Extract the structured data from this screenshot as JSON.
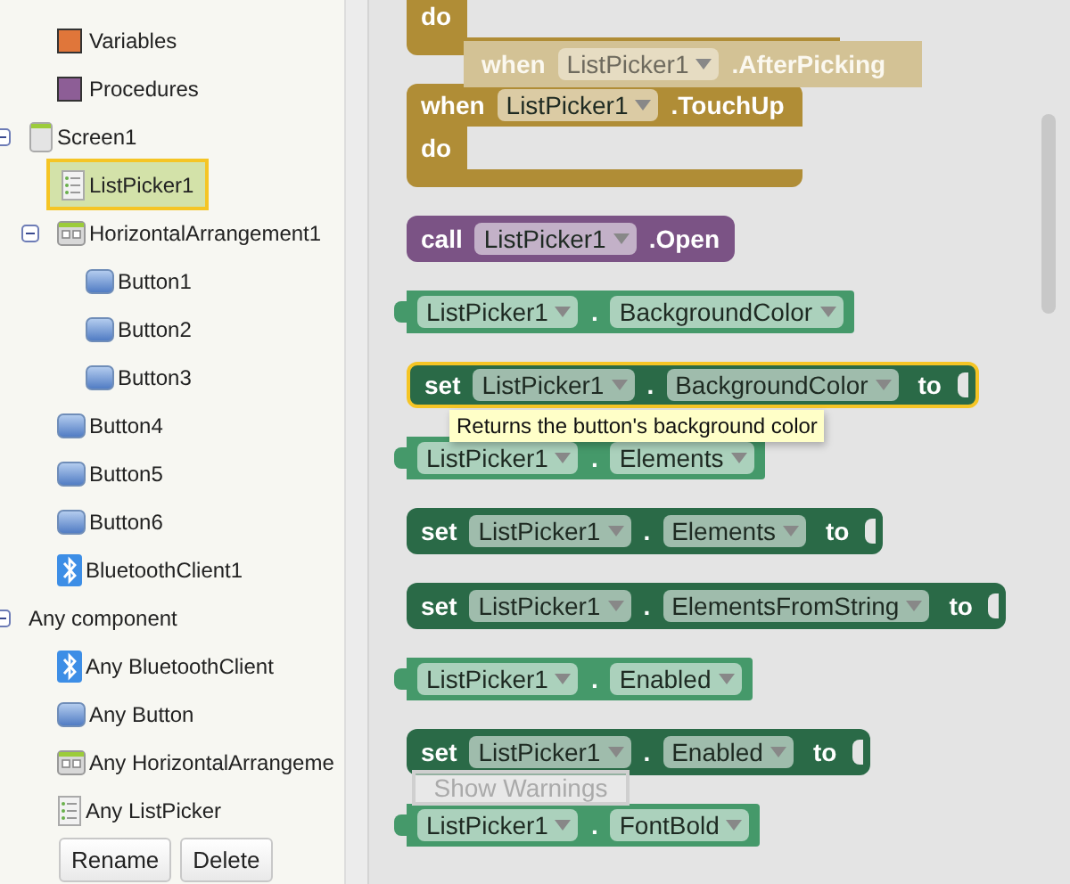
{
  "builtin": [
    {
      "label": "Variables",
      "color": "#e0763a"
    },
    {
      "label": "Procedures",
      "color": "#8d5e96"
    }
  ],
  "tree": [
    {
      "label": "Screen1",
      "kind": "screen",
      "expanded": true,
      "selected": false,
      "children": [
        {
          "label": "ListPicker1",
          "kind": "listpicker",
          "selected": true
        },
        {
          "label": "HorizontalArrangement1",
          "kind": "arrangement",
          "expanded": true,
          "selected": false,
          "children": [
            {
              "label": "Button1",
              "kind": "button",
              "selected": false
            },
            {
              "label": "Button2",
              "kind": "button",
              "selected": false
            },
            {
              "label": "Button3",
              "kind": "button",
              "selected": false
            }
          ]
        },
        {
          "label": "Button4",
          "kind": "button",
          "selected": false
        },
        {
          "label": "Button5",
          "kind": "button",
          "selected": false
        },
        {
          "label": "Button6",
          "kind": "button",
          "selected": false
        },
        {
          "label": "BluetoothClient1",
          "kind": "bluetooth",
          "selected": false
        }
      ]
    },
    {
      "label": "Any component",
      "kind": "group",
      "expanded": true,
      "selected": false,
      "children": [
        {
          "label": "Any BluetoothClient",
          "kind": "bluetooth",
          "selected": false
        },
        {
          "label": "Any Button",
          "kind": "button",
          "selected": false
        },
        {
          "label": "Any HorizontalArrangeme",
          "kind": "arrangement",
          "selected": false
        },
        {
          "label": "Any ListPicker",
          "kind": "listpicker",
          "selected": false
        }
      ]
    }
  ],
  "panel_buttons": [
    "Rename",
    "Delete"
  ],
  "drag_ghost": {
    "keyword": "when",
    "component": "ListPicker1",
    "member": ".AfterPicking"
  },
  "blocks": [
    {
      "kind": "event",
      "do": "do",
      "selected": false
    },
    {
      "kind": "event",
      "keyword": "when",
      "component": "ListPicker1",
      "member": ".TouchUp",
      "do": "do",
      "selected": false
    },
    {
      "kind": "call",
      "keyword": "call",
      "component": "ListPicker1",
      "member": ".Open",
      "selected": false
    },
    {
      "kind": "getter",
      "component": "ListPicker1",
      "dot": ".",
      "member": "BackgroundColor",
      "selected": false
    },
    {
      "kind": "setter",
      "keyword": "set",
      "component": "ListPicker1",
      "dot": ".",
      "member": "BackgroundColor",
      "to": "to",
      "selected": true
    },
    {
      "kind": "getter",
      "component": "ListPicker1",
      "dot": ".",
      "member": "Elements",
      "selected": false
    },
    {
      "kind": "setter",
      "keyword": "set",
      "component": "ListPicker1",
      "dot": ".",
      "member": "Elements",
      "to": "to",
      "selected": false
    },
    {
      "kind": "setter",
      "keyword": "set",
      "component": "ListPicker1",
      "dot": ".",
      "member": "ElementsFromString",
      "to": "to",
      "selected": false
    },
    {
      "kind": "getter",
      "component": "ListPicker1",
      "dot": ".",
      "member": "Enabled",
      "selected": false
    },
    {
      "kind": "setter",
      "keyword": "set",
      "component": "ListPicker1",
      "dot": ".",
      "member": "Enabled",
      "to": "to",
      "selected": false
    },
    {
      "kind": "getter",
      "component": "ListPicker1",
      "dot": ".",
      "member": "FontBold",
      "selected": false
    }
  ],
  "tooltip": "Returns the button's background color",
  "warnings_button": {
    "label": "Show Warnings"
  }
}
